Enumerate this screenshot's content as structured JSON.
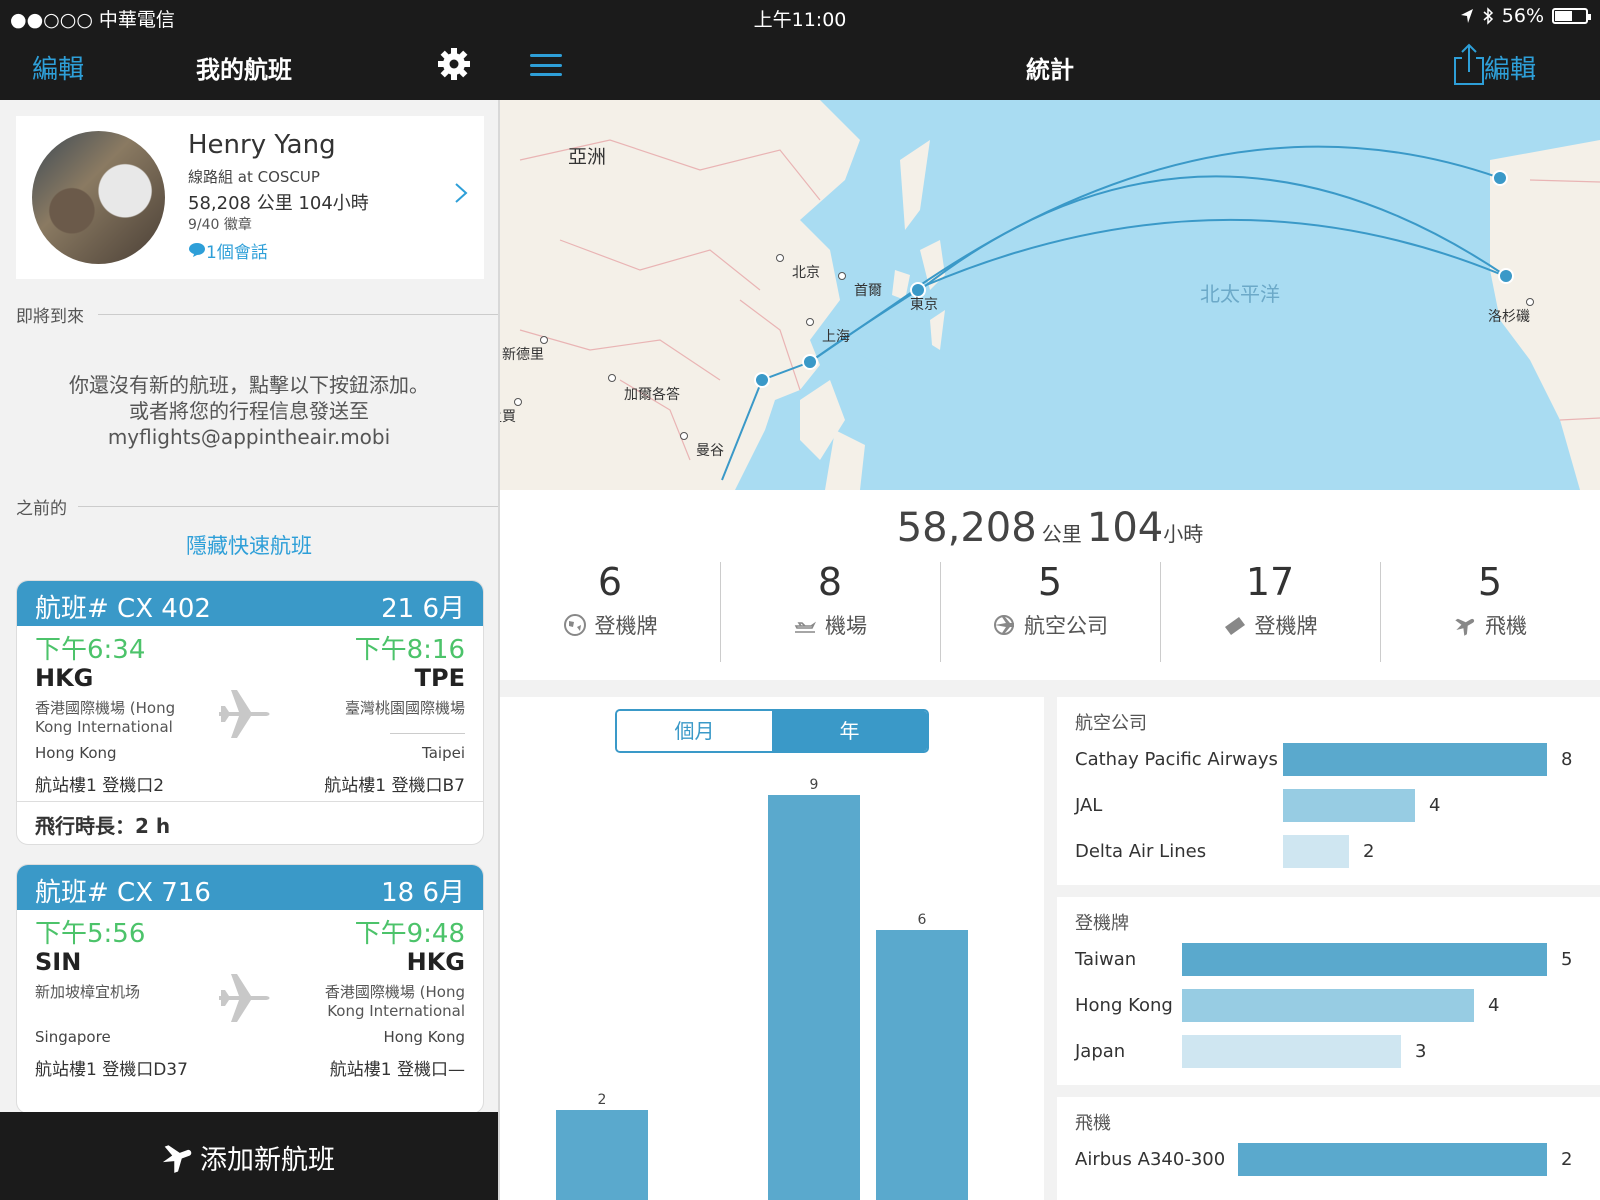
{
  "status_bar": {
    "carrier": "●●○○○ 中華電信",
    "time": "上午11:00",
    "battery": "56%",
    "battery_level": 0.56
  },
  "left_nav": {
    "edit_label": "編輯",
    "title": "我的航班",
    "icon": "gear-icon"
  },
  "right_nav": {
    "title": "統計",
    "edit_label": "編輯",
    "menu_icon": "hamburger-icon",
    "share_icon": "share-icon"
  },
  "profile": {
    "name": "Henry Yang",
    "role": "線路組 at COSCUP",
    "stats": "58,208 公里 104小時",
    "badges": "9/40 徽章",
    "chat": "1個會話"
  },
  "upcoming": {
    "heading": "即將到來",
    "empty_line1": "你還沒有新的航班，點擊以下按鈕添加。",
    "empty_line2": "或者將您的行程信息發送至",
    "email": "myflights@appintheair.mobi"
  },
  "previous": {
    "heading": "之前的",
    "hide_link": "隱藏快速航班"
  },
  "flights": [
    {
      "number": "航班# CX 402",
      "date": "21 6月",
      "dep_time": "下午6:34",
      "arr_time": "下午8:16",
      "dep_code": "HKG",
      "arr_code": "TPE",
      "dep_airport": "香港國際機場 (Hong Kong International",
      "arr_airport": "臺灣桃園國際機場",
      "dep_city": "Hong Kong",
      "arr_city": "Taipei",
      "dep_gate": "航站樓1  登機口2",
      "arr_gate": "航站樓1  登機口B7",
      "duration": "飛行時長：2 h"
    },
    {
      "number": "航班# CX 716",
      "date": "18 6月",
      "dep_time": "下午5:56",
      "arr_time": "下午9:48",
      "dep_code": "SIN",
      "arr_code": "HKG",
      "dep_airport": "新加坡樟宜机场",
      "arr_airport": "香港國際機場 (Hong Kong International",
      "dep_city": "Singapore",
      "arr_city": "Hong Kong",
      "dep_gate": "航站樓1  登機口D37",
      "arr_gate": "航站樓1  登機口—"
    }
  ],
  "add_button": {
    "label": "添加新航班",
    "icon": "plane-icon"
  },
  "map": {
    "labels": {
      "asia": "亞洲",
      "beijing": "北京",
      "seoul": "首爾",
      "tokyo": "東京",
      "shanghai": "上海",
      "delhi": "新德里",
      "kolkata": "加爾各答",
      "mumbai": "孟買",
      "bangkok": "曼谷",
      "pacific": "北太平洋",
      "la": "洛杉磯"
    }
  },
  "totals": {
    "distance": "58,208",
    "distance_unit": "公里",
    "hours": "104",
    "hours_unit": "小時",
    "items": [
      {
        "value": "6",
        "label": "登機牌",
        "icon": "globe-icon"
      },
      {
        "value": "8",
        "label": "機場",
        "icon": "airport-icon"
      },
      {
        "value": "5",
        "label": "航空公司",
        "icon": "airline-icon"
      },
      {
        "value": "17",
        "label": "登機牌",
        "icon": "ticket-icon"
      },
      {
        "value": "5",
        "label": "飛機",
        "icon": "plane-icon"
      }
    ]
  },
  "segmented": {
    "month": "個月",
    "year": "年",
    "selected": "year"
  },
  "chart_data": {
    "type": "bar",
    "categories": [
      "",
      "",
      "",
      ""
    ],
    "values": [
      2,
      null,
      9,
      6
    ],
    "ylim": [
      0,
      9.5
    ],
    "color": "#5aa9cd"
  },
  "airlines": {
    "heading": "航空公司",
    "rows": [
      {
        "name": "Cathay Pacific Airways",
        "value": 8
      },
      {
        "name": "JAL",
        "value": 4
      },
      {
        "name": "Delta Air Lines",
        "value": 2
      }
    ]
  },
  "boarding": {
    "heading": "登機牌",
    "rows": [
      {
        "name": "Taiwan",
        "value": 5
      },
      {
        "name": "Hong Kong",
        "value": 4
      },
      {
        "name": "Japan",
        "value": 3
      }
    ]
  },
  "aircraft": {
    "heading": "飛機",
    "rows": [
      {
        "name": "Airbus A340-300",
        "value": 2
      }
    ]
  },
  "colors": {
    "accent": "#2e9fd8",
    "bar_dark": "#5aa9cd",
    "bar_mid": "#97cce3",
    "bar_light": "#cfe6f1",
    "green_time": "#4cc36a",
    "navbar": "#1b1b1b"
  }
}
